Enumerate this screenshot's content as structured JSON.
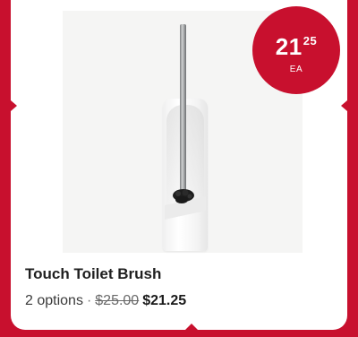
{
  "product": {
    "title": "Touch Toilet Brush",
    "options": "2 options",
    "separator": "·",
    "original_price": "$25.00",
    "sale_price": "$21.25",
    "image_alt": "Touch Toilet Brush"
  },
  "badge": {
    "price_whole": "21",
    "price_cents": "25",
    "unit": "EA"
  },
  "colors": {
    "brand_red": "#c8102e",
    "card_bg": "#ffffff",
    "image_bg": "#f5f5f4"
  }
}
